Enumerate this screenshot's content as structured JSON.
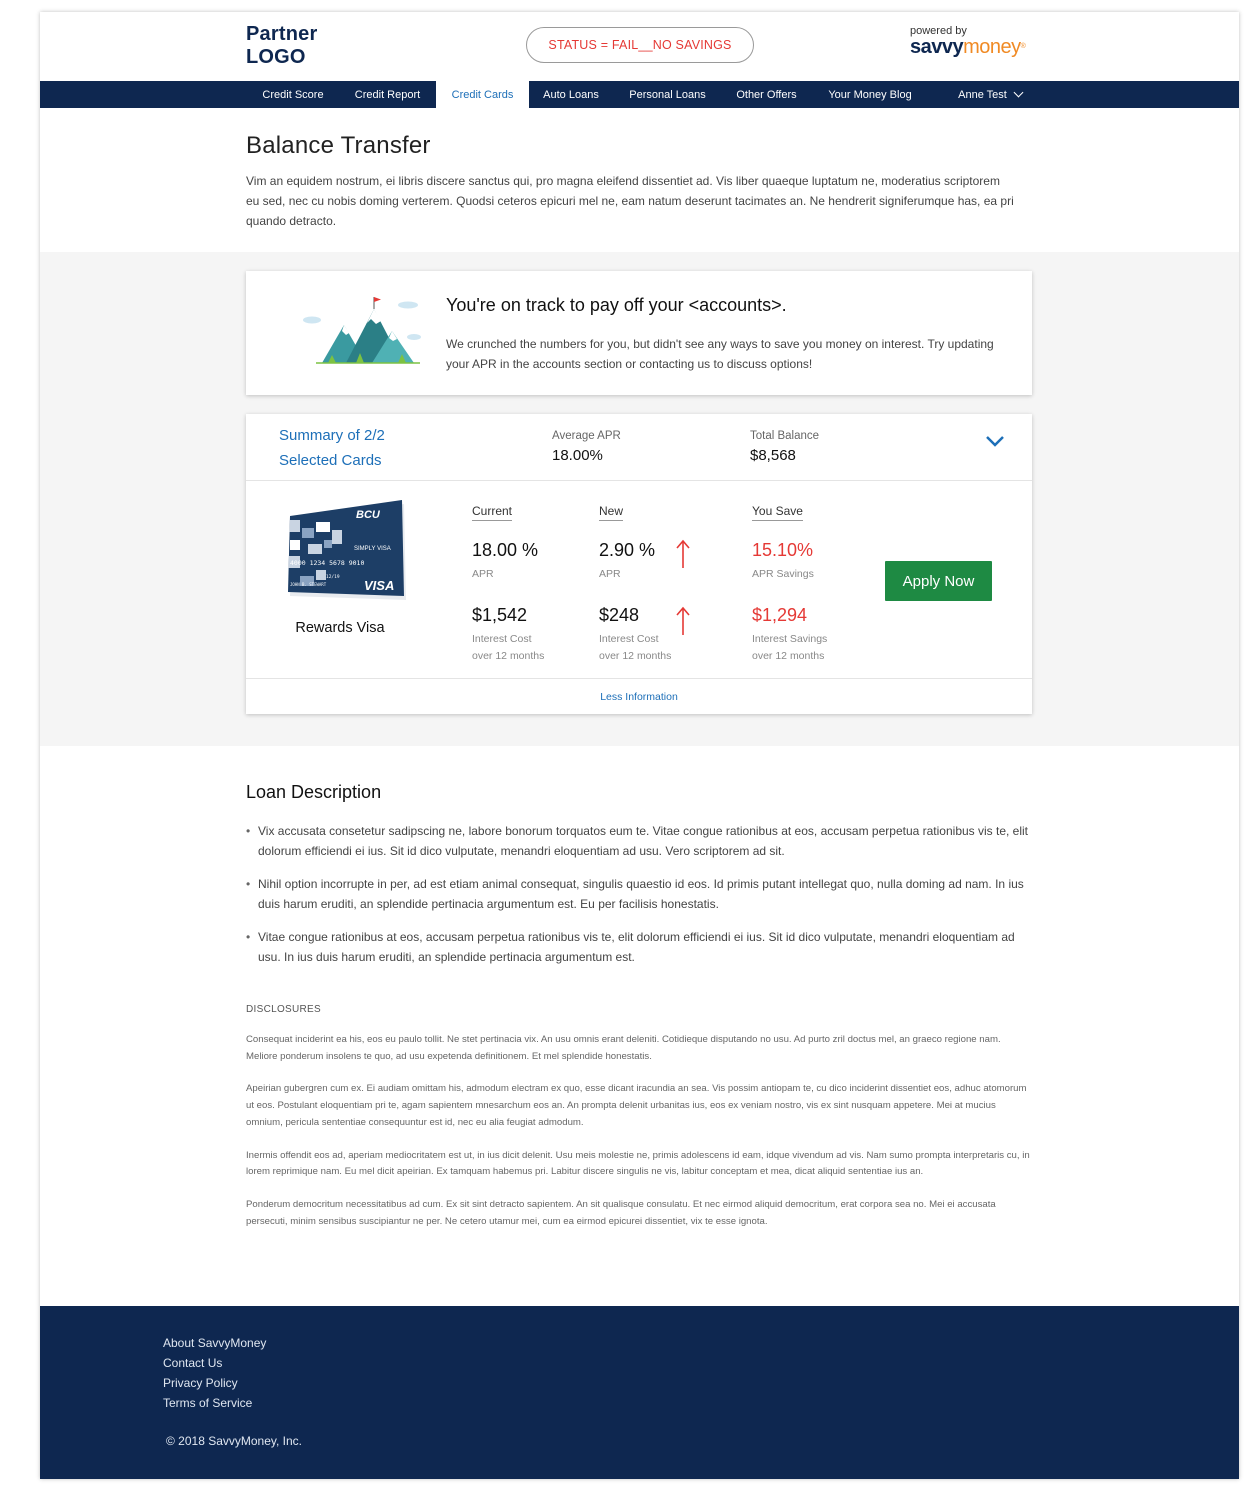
{
  "header": {
    "logo_line1": "Partner",
    "logo_line2": "LOGO",
    "status": "STATUS = FAIL__NO SAVINGS",
    "powered_by": "powered by",
    "brand_part1": "savvy",
    "brand_part2": "money",
    "brand_reg": "®"
  },
  "nav": {
    "items": [
      {
        "label": "Credit Score"
      },
      {
        "label": "Credit Report"
      },
      {
        "label": "Credit Cards"
      },
      {
        "label": "Auto Loans"
      },
      {
        "label": "Personal Loans"
      },
      {
        "label": "Other Offers"
      },
      {
        "label": "Your Money Blog"
      }
    ],
    "active": "Credit Cards",
    "user": "Anne Test"
  },
  "hero": {
    "title": "Balance Transfer",
    "description": "Vim an equidem nostrum, ei libris discere sanctus qui, pro magna eleifend dissentiet ad. Vis liber quaeque luptatum ne, moderatius scriptorem eu sed, nec cu nobis doming verterem. Quodsi ceteros epicuri mel ne, eam natum deserunt tacimates an. Ne hendrerit signiferumque has, ea pri quando detracto."
  },
  "status_card": {
    "title": "You're on track to pay off your <accounts>.",
    "message": "We crunched the numbers for you, but didn't see any ways to save you money on interest. Try updating your APR in the accounts section or contacting us to discuss options!"
  },
  "summary": {
    "title_line1": "Summary of 2/2",
    "title_line2": "Selected Cards",
    "avg_apr_label": "Average APR",
    "avg_apr_value": "18.00%",
    "total_balance_label": "Total Balance",
    "total_balance_value": "$8,568"
  },
  "card_detail": {
    "card_name": "Rewards Visa",
    "card_image_text": {
      "bank": "BCU",
      "type": "SIMPLY VISA",
      "number": "4000 1234 5678 9010",
      "expiry": "12/19",
      "holder": "JOHN B. STEWART",
      "network": "VISA"
    },
    "current": {
      "header": "Current",
      "apr": "18.00 %",
      "apr_label": "APR",
      "cost": "$1,542",
      "cost_label_1": "Interest Cost",
      "cost_label_2": "over 12 months"
    },
    "new": {
      "header": "New",
      "apr": "2.90 %",
      "apr_label": "APR",
      "cost": "$248",
      "cost_label_1": "Interest Cost",
      "cost_label_2": "over 12 months"
    },
    "save": {
      "header": "You Save",
      "apr": "15.10%",
      "apr_label": "APR Savings",
      "cost": "$1,294",
      "cost_label_1": "Interest Savings",
      "cost_label_2": "over 12 months"
    },
    "apply_label": "Apply Now",
    "less_info": "Less Information"
  },
  "loan": {
    "title": "Loan Description",
    "bullets": [
      "Vix accusata consetetur sadipscing ne, labore bonorum torquatos eum te. Vitae congue rationibus at eos, accusam perpetua rationibus vis te, elit dolorum efficiendi ei ius. Sit id dico vulputate, menandri eloquentiam ad usu. Vero scriptorem ad sit.",
      "Nihil option incorrupte in per, ad est etiam animal consequat, singulis quaestio id eos. Id primis putant intellegat quo, nulla doming ad nam. In ius duis harum eruditi, an splendide pertinacia argumentum est. Eu per facilisis honestatis.",
      "Vitae congue rationibus at eos, accusam perpetua rationibus vis te, elit dolorum efficiendi ei ius. Sit id dico vulputate, menandri eloquentiam ad usu. In ius duis harum eruditi, an splendide pertinacia argumentum est."
    ]
  },
  "disclosures": {
    "title": "DISCLOSURES",
    "paragraphs": [
      "Consequat inciderint ea his, eos eu paulo tollit. Ne stet pertinacia vix. An usu omnis erant deleniti. Cotidieque disputando no usu. Ad purto zril doctus mel, an graeco regione nam. Meliore ponderum insolens te quo, ad usu expetenda definitionem. Et mel splendide honestatis.",
      "Apeirian gubergren cum ex. Ei audiam omittam his, admodum electram ex quo, esse dicant iracundia an sea. Vis possim antiopam te, cu dico inciderint dissentiet eos, adhuc atomorum ut eos. Postulant eloquentiam pri te, agam sapientem mnesarchum eos an. An prompta delenit urbanitas ius, eos ex veniam nostro, vis ex sint nusquam appetere. Mei at mucius omnium, pericula sententiae consequuntur est id, nec eu alia feugiat admodum.",
      "Inermis offendit eos ad, aperiam mediocritatem est ut, in ius dicit delenit. Usu meis molestie ne, primis adolescens id eam, idque vivendum ad vis. Nam sumo prompta interpretaris cu, in lorem reprimique nam. Eu mel dicit apeirian. Ex tamquam habemus pri. Labitur discere singulis ne vis, labitur conceptam et mea, dicat aliquid sententiae ius an.",
      "Ponderum democritum necessitatibus ad cum. Ex sit sint detracto sapientem. An sit qualisque consulatu. Et nec eirmod aliquid democritum, erat corpora sea no. Mei ei accusata persecuti, minim sensibus suscipiantur ne per. Ne cetero utamur mei, cum ea eirmod epicurei dissentiet, vix te esse ignota."
    ]
  },
  "footer": {
    "links": [
      "About SavvyMoney",
      "Contact Us",
      "Privacy Policy",
      "Terms of Service"
    ],
    "copyright": "© 2018 SavvyMoney, Inc."
  },
  "colors": {
    "navy": "#0e2750",
    "link_blue": "#1d6fb8",
    "status_red": "#e53935",
    "apply_green": "#1e8a43",
    "brand_orange": "#f08a24"
  }
}
